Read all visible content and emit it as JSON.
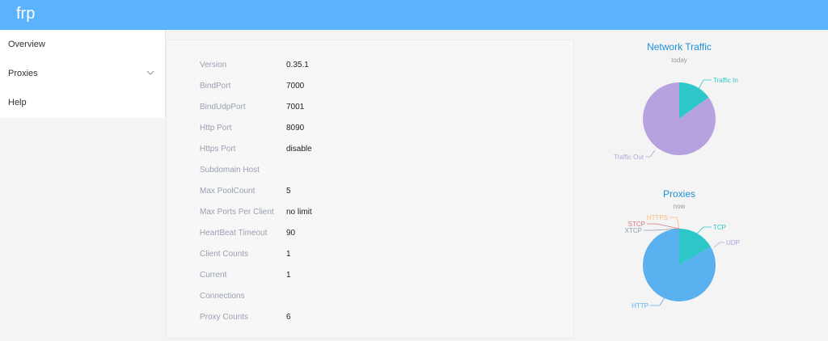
{
  "app": {
    "title": "frp"
  },
  "sidebar": {
    "items": [
      {
        "label": "Overview"
      },
      {
        "label": "Proxies"
      },
      {
        "label": "Help"
      }
    ]
  },
  "overview": {
    "rows": [
      {
        "key": "Version",
        "value": "0.35.1"
      },
      {
        "key": "BindPort",
        "value": "7000"
      },
      {
        "key": "BindUdpPort",
        "value": "7001"
      },
      {
        "key": "Http Port",
        "value": "8090"
      },
      {
        "key": "Https Port",
        "value": "disable"
      },
      {
        "key": "Subdomain Host",
        "value": ""
      },
      {
        "key": "Max PoolCount",
        "value": "5"
      },
      {
        "key": "Max Ports Per Client",
        "value": "no limit"
      },
      {
        "key": "HeartBeat Timeout",
        "value": "90"
      },
      {
        "key": "Client Counts",
        "value": "1"
      },
      {
        "key": "Current",
        "value": "1"
      },
      {
        "key": "Connections",
        "value": ""
      },
      {
        "key": "Proxy Counts",
        "value": "6"
      }
    ]
  },
  "colors": {
    "header": "#5bb3fb",
    "traffic_in": "#2ec7c9",
    "traffic_out": "#b6a2de",
    "http": "#5ab1ef",
    "tcp": "#2ec7c9",
    "udp": "#b6a2de",
    "https": "#ffb980",
    "stcp": "#d87a80",
    "xtcp": "#8d98b3"
  },
  "chart_data": [
    {
      "type": "pie",
      "title": "Network Traffic",
      "subtitle": "today",
      "slices": [
        {
          "name": "Traffic In",
          "value": 15
        },
        {
          "name": "Traffic Out",
          "value": 85
        }
      ]
    },
    {
      "type": "pie",
      "title": "Proxies",
      "subtitle": "now",
      "slices": [
        {
          "name": "TCP",
          "value": 1
        },
        {
          "name": "UDP",
          "value": 0
        },
        {
          "name": "HTTP",
          "value": 5
        },
        {
          "name": "HTTPS",
          "value": 0
        },
        {
          "name": "STCP",
          "value": 0
        },
        {
          "name": "XTCP",
          "value": 0
        }
      ]
    }
  ]
}
